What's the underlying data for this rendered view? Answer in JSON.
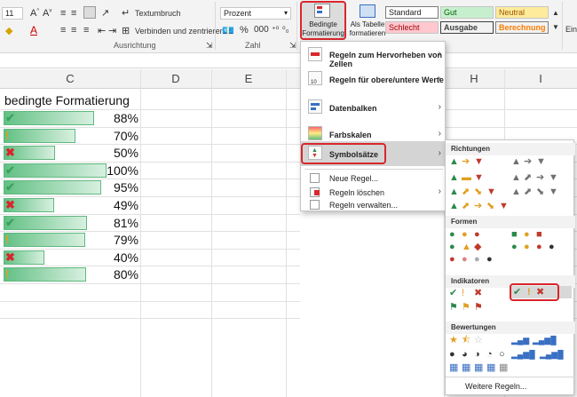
{
  "ribbon": {
    "font_size": "11",
    "wrap_text": "Textumbruch",
    "merge_center": "Verbinden und zentrieren",
    "number_format": "Prozent",
    "alignment_group": "Ausrichtung",
    "number_group": "Zahl",
    "cond_format_line1": "Bedingte",
    "cond_format_line2": "Formatierung",
    "as_table_line1": "Als Tabelle",
    "as_table_line2": "formatieren",
    "insert_label": "Einf",
    "styles": {
      "standard": "Standard",
      "gut": "Gut",
      "neutral": "Neutral",
      "schlecht": "Schlecht",
      "ausgabe": "Ausgabe",
      "berechnung": "Berechnung"
    }
  },
  "columns": [
    "C",
    "D",
    "E",
    "H",
    "I"
  ],
  "sheet": {
    "header_cell": "bedingte Formatierung",
    "rows": [
      {
        "value": "88%",
        "pct": 88,
        "icon": "check"
      },
      {
        "value": "70%",
        "pct": 70,
        "icon": "exclamation"
      },
      {
        "value": "50%",
        "pct": 50,
        "icon": "cross"
      },
      {
        "value": "100%",
        "pct": 100,
        "icon": "check"
      },
      {
        "value": "95%",
        "pct": 95,
        "icon": "check"
      },
      {
        "value": "49%",
        "pct": 49,
        "icon": "cross"
      },
      {
        "value": "81%",
        "pct": 81,
        "icon": "check"
      },
      {
        "value": "79%",
        "pct": 79,
        "icon": "exclamation"
      },
      {
        "value": "40%",
        "pct": 40,
        "icon": "cross"
      },
      {
        "value": "80%",
        "pct": 80,
        "icon": "exclamation"
      }
    ]
  },
  "menu": {
    "items": [
      {
        "label": "Regeln zum Hervorheben von Zellen"
      },
      {
        "label": "Regeln für obere/untere Werte"
      },
      {
        "label": "Datenbalken"
      },
      {
        "label": "Farbskalen"
      },
      {
        "label": "Symbolsätze"
      },
      {
        "label": "Neue Regel..."
      },
      {
        "label": "Regeln löschen"
      },
      {
        "label": "Regeln verwalten..."
      }
    ]
  },
  "submenu": {
    "sections": [
      "Richtungen",
      "Formen",
      "Indikatoren",
      "Bewertungen"
    ],
    "more_rules": "Weitere Regeln..."
  }
}
